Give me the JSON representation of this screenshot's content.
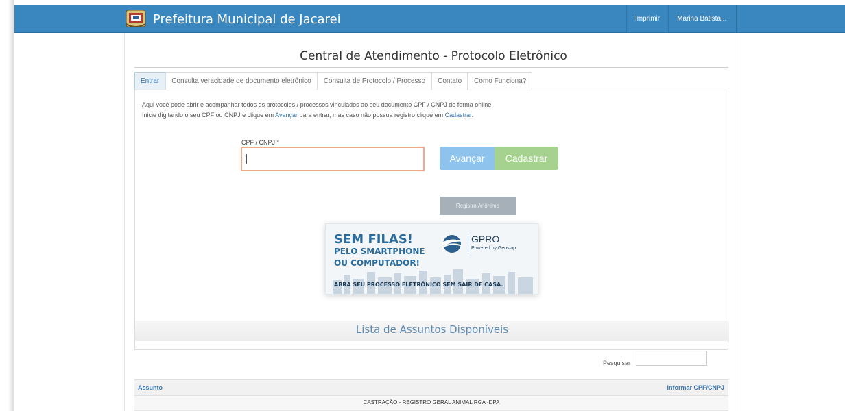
{
  "header": {
    "brand_title": "Prefeitura Municipal de Jacarei",
    "print_label": "Imprimir",
    "user_label": "Marina Batista..."
  },
  "main": {
    "title": "Central de Atendimento - Protocolo Eletrônico",
    "tabs": [
      {
        "label": "Entrar",
        "active": true
      },
      {
        "label": "Consulta veracidade de documento eletrônico",
        "active": false
      },
      {
        "label": "Consulta de Protocolo / Processo",
        "active": false
      },
      {
        "label": "Contato",
        "active": false
      },
      {
        "label": "Como Funciona?",
        "active": false
      }
    ],
    "intro_line1": "Aqui você pode abrir e acompanhar todos os protocolos / processos vinculados ao seu documento CPF / CNPJ de forma online.",
    "intro_line2_pre": "Inicie digitando o seu CPF ou CNPJ e clique em ",
    "intro_link_avancar": "Avançar",
    "intro_line2_mid": " para entrar, mas caso não possua registro clique em ",
    "intro_link_cadastrar": "Cadastrar",
    "intro_line2_post": ".",
    "cpf_label": "CPF / CNPJ *",
    "cpf_value": "",
    "avancar_label": "Avançar",
    "cadastrar_label": "Cadastrar",
    "anonimo_label": "Registro Anônimo"
  },
  "banner": {
    "line1": "SEM FILAS!",
    "line2": "PELO SMARTPHONE",
    "line3": "OU COMPUTADOR!",
    "line4": "ABRA SEU PROCESSO ELETRÔNICO SEM SAIR DE CASA.",
    "brand": "GPRO",
    "brand_sub": "Powered by Geosiap"
  },
  "list": {
    "title": "Lista de Assuntos Disponíveis",
    "search_label": "Pesquisar",
    "search_value": "",
    "col_left": "Assunto",
    "col_right": "Informar CPF/CNPJ",
    "rows": [
      "CASTRAÇÃO - REGISTRO GERAL ANIMAL RGA -DPA"
    ]
  },
  "colors": {
    "navbar": "#3a87c0",
    "link": "#3a76ad",
    "avancar": "#8dc3ec",
    "cadastrar": "#a6d28f"
  }
}
